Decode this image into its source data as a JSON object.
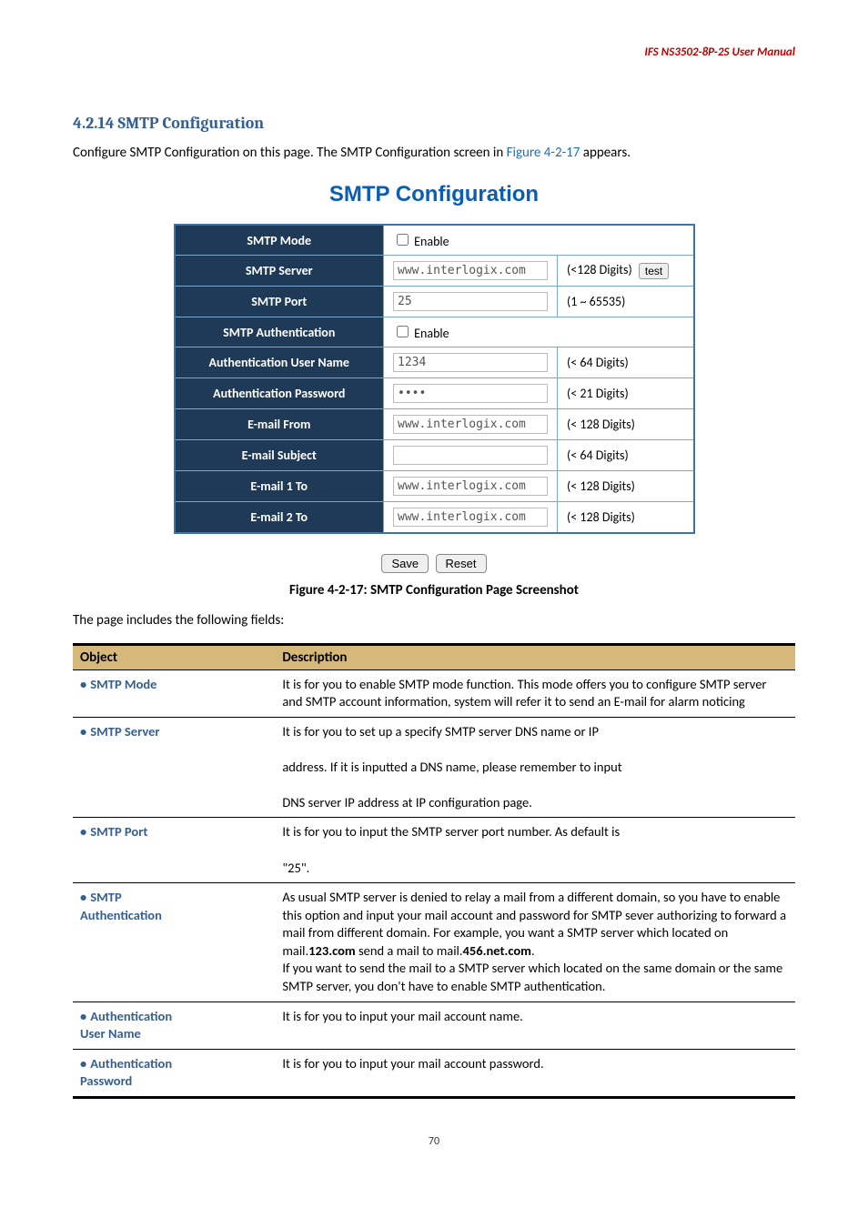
{
  "header": {
    "product": "IFS NS3502-8P-2S  User  Manual"
  },
  "section": {
    "number": "4.2.14",
    "title": "SMTP Configuration",
    "intro_before": "Configure SMTP Configuration on this page. The SMTP Configuration screen in ",
    "figref": "Figure 4-2-17",
    "intro_after": " appears."
  },
  "form": {
    "title": "SMTP Configuration",
    "rows": {
      "mode": {
        "label": "SMTP Mode",
        "checkbox_label": "Enable",
        "checked": false
      },
      "server": {
        "label": "SMTP Server",
        "value": "www.interlogix.com",
        "limit": "(<128 Digits)",
        "test_btn": "test"
      },
      "port": {
        "label": "SMTP Port",
        "value": "25",
        "limit": "(1 ~ 65535)"
      },
      "auth": {
        "label": "SMTP Authentication",
        "checkbox_label": "Enable",
        "checked": false
      },
      "user": {
        "label": "Authentication User Name",
        "value": "1234",
        "limit": "(< 64 Digits)"
      },
      "pass": {
        "label": "Authentication Password",
        "value": "••••",
        "limit": "(< 21 Digits)"
      },
      "from": {
        "label": "E-mail From",
        "value": "www.interlogix.com",
        "limit": "(< 128 Digits)"
      },
      "subject": {
        "label": "E-mail Subject",
        "value": "",
        "limit": "(< 64 Digits)"
      },
      "to1": {
        "label": "E-mail 1 To",
        "value": "www.interlogix.com",
        "limit": "(< 128 Digits)"
      },
      "to2": {
        "label": "E-mail 2 To",
        "value": "www.interlogix.com",
        "limit": "(< 128 Digits)"
      }
    },
    "buttons": {
      "save": "Save",
      "reset": "Reset"
    }
  },
  "caption": {
    "prefix": "Figure 4-2-17",
    "rest": ": SMTP Configuration Page Screenshot"
  },
  "fields_intro": "The page includes the following fields:",
  "table": {
    "head_object": "Object",
    "head_desc": "Description",
    "rows": [
      {
        "obj": "SMTP Mode",
        "desc": "It is for you to enable SMTP mode function. This mode offers you to configure SMTP server and SMTP account information, system will refer it to send an E-mail for alarm noticing"
      },
      {
        "obj": "SMTP Server",
        "desc": "It is for you to set up a specify SMTP server DNS name or IP address. If it is inputted a DNS name, please remember to input DNS server IP address at IP configuration page."
      },
      {
        "obj": "SMTP Port",
        "desc": "It is for you to input the SMTP server port number. As default is \"25\"."
      },
      {
        "obj": "SMTP Authentication",
        "desc": "As usual SMTP server is denied to relay a mail from a different domain, so you have to enable this option and input your mail account and password for SMTP sever authorizing to forward a mail from different domain. For example, you want a SMTP server which located on mail.123.com send a mail to mail.456.net.com.\nIf you want to send the mail to a SMTP server which located on the same domain or the same SMTP server, you don't have to enable SMTP authentication."
      },
      {
        "obj": "Authentication User Name",
        "desc": "It is for you to input your mail account name."
      },
      {
        "obj": "Authentication Password",
        "desc": "It is for you to input your mail account password."
      }
    ]
  },
  "page_number": "70"
}
